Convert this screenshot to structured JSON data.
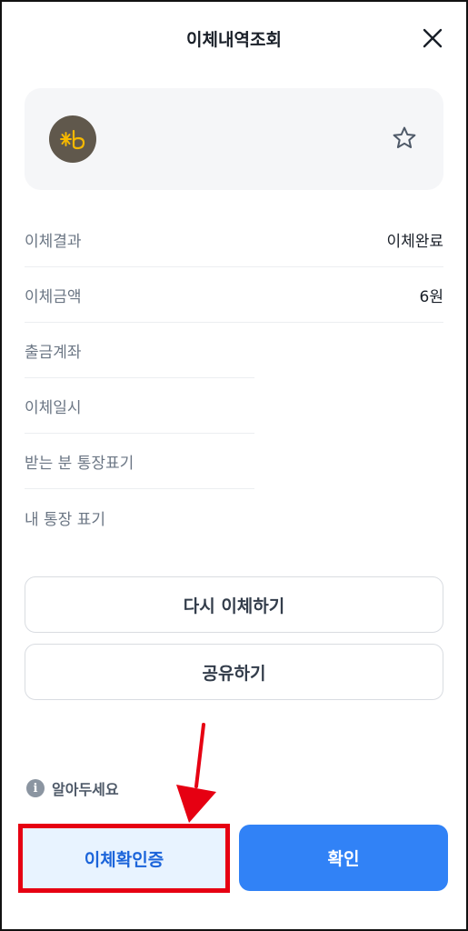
{
  "header": {
    "title": "이체내역조회",
    "close_icon": "close-icon"
  },
  "bank_card": {
    "logo_icon": "kb-bank-logo-icon",
    "favorite_icon": "star-outline-icon"
  },
  "details": [
    {
      "label": "이체결과",
      "value": "이체완료"
    },
    {
      "label": "이체금액",
      "value": "6원"
    },
    {
      "label": "출금계좌",
      "value": ""
    },
    {
      "label": "이체일시",
      "value": ""
    },
    {
      "label": "받는 분 통장표기",
      "value": ""
    },
    {
      "label": "내 통장 표기",
      "value": ""
    }
  ],
  "buttons": {
    "retry_label": "다시 이체하기",
    "share_label": "공유하기",
    "certificate_label": "이체확인증",
    "confirm_label": "확인"
  },
  "notice": {
    "label": "알아두세요",
    "icon": "info-icon"
  },
  "colors": {
    "accent": "#3182f6",
    "highlight_box": "#e60012",
    "annotation_arrow": "#e60012",
    "card_bg": "#f5f6f8",
    "logo_bg": "#60584c",
    "logo_star": "#f5b800"
  }
}
